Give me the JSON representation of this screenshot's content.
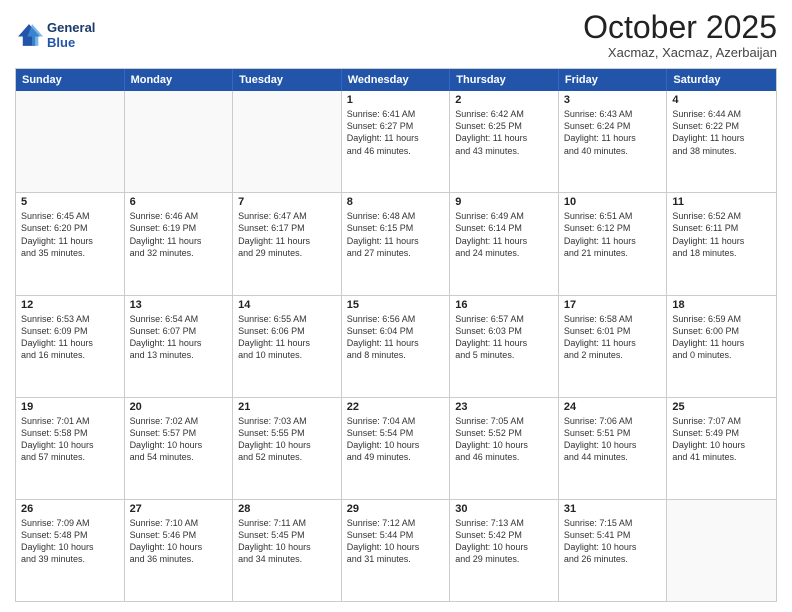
{
  "logo": {
    "line1": "General",
    "line2": "Blue"
  },
  "title": "October 2025",
  "subtitle": "Xacmaz, Xacmaz, Azerbaijan",
  "headers": [
    "Sunday",
    "Monday",
    "Tuesday",
    "Wednesday",
    "Thursday",
    "Friday",
    "Saturday"
  ],
  "rows": [
    [
      {
        "day": "",
        "info": ""
      },
      {
        "day": "",
        "info": ""
      },
      {
        "day": "",
        "info": ""
      },
      {
        "day": "1",
        "info": "Sunrise: 6:41 AM\nSunset: 6:27 PM\nDaylight: 11 hours\nand 46 minutes."
      },
      {
        "day": "2",
        "info": "Sunrise: 6:42 AM\nSunset: 6:25 PM\nDaylight: 11 hours\nand 43 minutes."
      },
      {
        "day": "3",
        "info": "Sunrise: 6:43 AM\nSunset: 6:24 PM\nDaylight: 11 hours\nand 40 minutes."
      },
      {
        "day": "4",
        "info": "Sunrise: 6:44 AM\nSunset: 6:22 PM\nDaylight: 11 hours\nand 38 minutes."
      }
    ],
    [
      {
        "day": "5",
        "info": "Sunrise: 6:45 AM\nSunset: 6:20 PM\nDaylight: 11 hours\nand 35 minutes."
      },
      {
        "day": "6",
        "info": "Sunrise: 6:46 AM\nSunset: 6:19 PM\nDaylight: 11 hours\nand 32 minutes."
      },
      {
        "day": "7",
        "info": "Sunrise: 6:47 AM\nSunset: 6:17 PM\nDaylight: 11 hours\nand 29 minutes."
      },
      {
        "day": "8",
        "info": "Sunrise: 6:48 AM\nSunset: 6:15 PM\nDaylight: 11 hours\nand 27 minutes."
      },
      {
        "day": "9",
        "info": "Sunrise: 6:49 AM\nSunset: 6:14 PM\nDaylight: 11 hours\nand 24 minutes."
      },
      {
        "day": "10",
        "info": "Sunrise: 6:51 AM\nSunset: 6:12 PM\nDaylight: 11 hours\nand 21 minutes."
      },
      {
        "day": "11",
        "info": "Sunrise: 6:52 AM\nSunset: 6:11 PM\nDaylight: 11 hours\nand 18 minutes."
      }
    ],
    [
      {
        "day": "12",
        "info": "Sunrise: 6:53 AM\nSunset: 6:09 PM\nDaylight: 11 hours\nand 16 minutes."
      },
      {
        "day": "13",
        "info": "Sunrise: 6:54 AM\nSunset: 6:07 PM\nDaylight: 11 hours\nand 13 minutes."
      },
      {
        "day": "14",
        "info": "Sunrise: 6:55 AM\nSunset: 6:06 PM\nDaylight: 11 hours\nand 10 minutes."
      },
      {
        "day": "15",
        "info": "Sunrise: 6:56 AM\nSunset: 6:04 PM\nDaylight: 11 hours\nand 8 minutes."
      },
      {
        "day": "16",
        "info": "Sunrise: 6:57 AM\nSunset: 6:03 PM\nDaylight: 11 hours\nand 5 minutes."
      },
      {
        "day": "17",
        "info": "Sunrise: 6:58 AM\nSunset: 6:01 PM\nDaylight: 11 hours\nand 2 minutes."
      },
      {
        "day": "18",
        "info": "Sunrise: 6:59 AM\nSunset: 6:00 PM\nDaylight: 11 hours\nand 0 minutes."
      }
    ],
    [
      {
        "day": "19",
        "info": "Sunrise: 7:01 AM\nSunset: 5:58 PM\nDaylight: 10 hours\nand 57 minutes."
      },
      {
        "day": "20",
        "info": "Sunrise: 7:02 AM\nSunset: 5:57 PM\nDaylight: 10 hours\nand 54 minutes."
      },
      {
        "day": "21",
        "info": "Sunrise: 7:03 AM\nSunset: 5:55 PM\nDaylight: 10 hours\nand 52 minutes."
      },
      {
        "day": "22",
        "info": "Sunrise: 7:04 AM\nSunset: 5:54 PM\nDaylight: 10 hours\nand 49 minutes."
      },
      {
        "day": "23",
        "info": "Sunrise: 7:05 AM\nSunset: 5:52 PM\nDaylight: 10 hours\nand 46 minutes."
      },
      {
        "day": "24",
        "info": "Sunrise: 7:06 AM\nSunset: 5:51 PM\nDaylight: 10 hours\nand 44 minutes."
      },
      {
        "day": "25",
        "info": "Sunrise: 7:07 AM\nSunset: 5:49 PM\nDaylight: 10 hours\nand 41 minutes."
      }
    ],
    [
      {
        "day": "26",
        "info": "Sunrise: 7:09 AM\nSunset: 5:48 PM\nDaylight: 10 hours\nand 39 minutes."
      },
      {
        "day": "27",
        "info": "Sunrise: 7:10 AM\nSunset: 5:46 PM\nDaylight: 10 hours\nand 36 minutes."
      },
      {
        "day": "28",
        "info": "Sunrise: 7:11 AM\nSunset: 5:45 PM\nDaylight: 10 hours\nand 34 minutes."
      },
      {
        "day": "29",
        "info": "Sunrise: 7:12 AM\nSunset: 5:44 PM\nDaylight: 10 hours\nand 31 minutes."
      },
      {
        "day": "30",
        "info": "Sunrise: 7:13 AM\nSunset: 5:42 PM\nDaylight: 10 hours\nand 29 minutes."
      },
      {
        "day": "31",
        "info": "Sunrise: 7:15 AM\nSunset: 5:41 PM\nDaylight: 10 hours\nand 26 minutes."
      },
      {
        "day": "",
        "info": ""
      }
    ]
  ]
}
